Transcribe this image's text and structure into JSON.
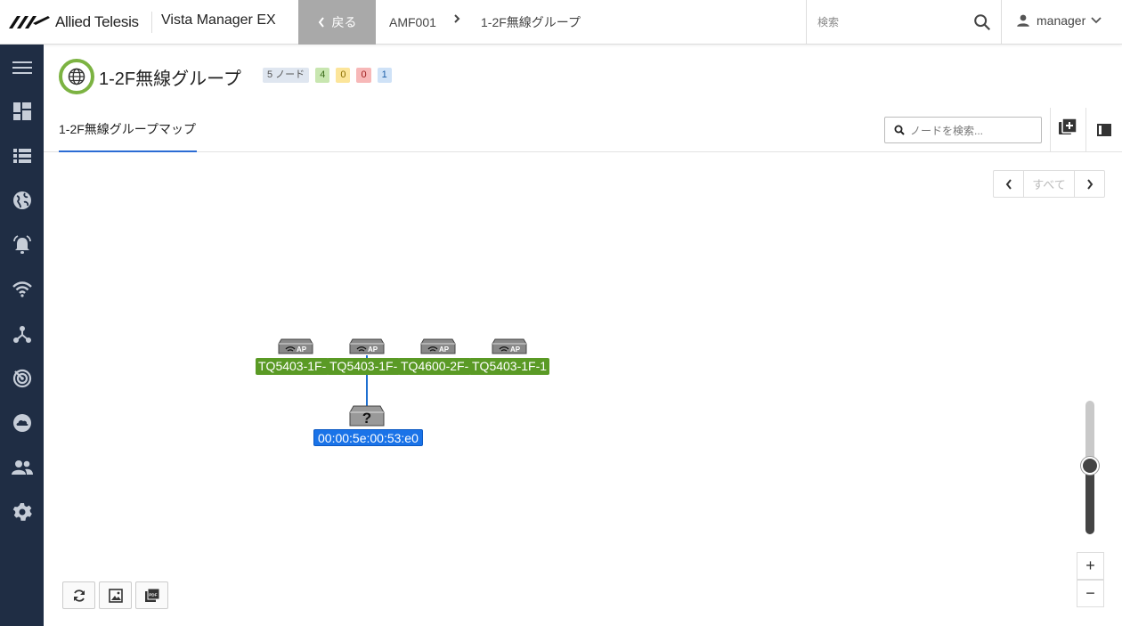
{
  "header": {
    "brand": "Allied Telesis",
    "product": "Vista Manager EX",
    "back_label": "戻る",
    "breadcrumb": [
      "AMF001",
      "1-2F無線グループ"
    ],
    "search_placeholder": "検索",
    "user": "manager"
  },
  "page": {
    "title": "1-2F無線グループ",
    "badges": {
      "nodes": "5 ノード",
      "ok": "4",
      "warning": "0",
      "error": "0",
      "info": "1"
    },
    "tab": "1-2F無線グループマップ",
    "node_search_placeholder": "ノードを検索..."
  },
  "pager": {
    "label": "すべて"
  },
  "map": {
    "nodes": [
      {
        "label": "TQ5403-1F-",
        "type": "ap"
      },
      {
        "label": "TQ5403-1F-",
        "type": "ap"
      },
      {
        "label": "TQ4600-2F-",
        "type": "ap"
      },
      {
        "label": "TQ5403-1F-1",
        "type": "ap"
      },
      {
        "label": "00:00:5e:00:53:e0",
        "type": "unknown"
      }
    ],
    "ap_icon_text": "AP",
    "unknown_icon_text": "?"
  },
  "zoom": {
    "plus": "+",
    "minus": "−",
    "level": 0.48
  },
  "colors": {
    "sidebar": "#1f2d44",
    "ap_label": "#5a9a25",
    "unknown_label": "#1a73e8",
    "link": "#1e6fd0",
    "accent": "#2b6cd4",
    "globe_ring": "#7cb342"
  }
}
